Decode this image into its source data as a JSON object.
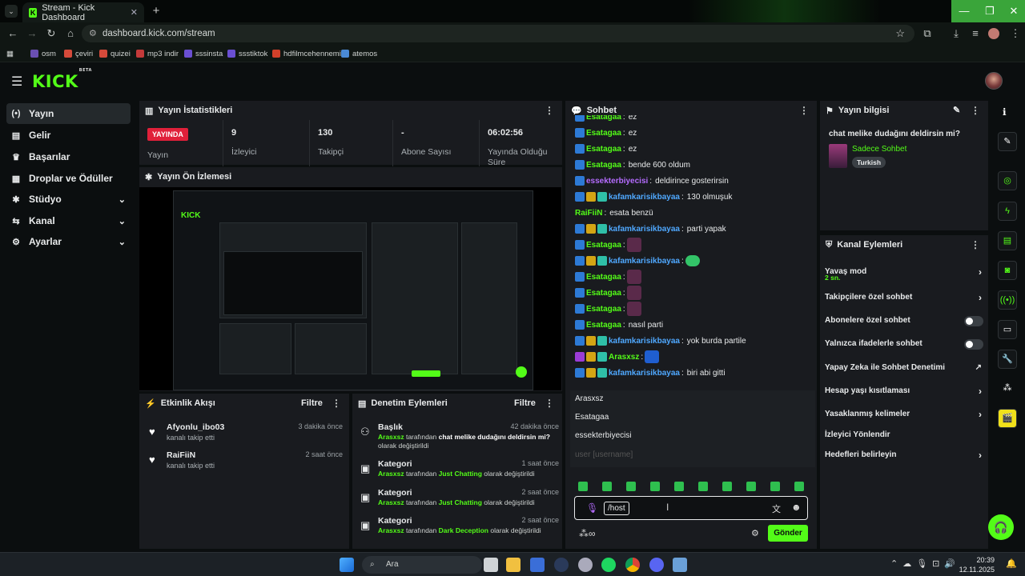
{
  "browser": {
    "tab_title": "Stream - Kick Dashboard",
    "url": "dashboard.kick.com/stream",
    "bookmarks": [
      "osm",
      "çeviri",
      "quizei",
      "mp3 indir",
      "sssinsta",
      "ssstiktok",
      "hdfilmcehennemi",
      "atemos"
    ]
  },
  "header": {
    "logo": "KICK",
    "logo_badge": "BETA"
  },
  "sidebar": {
    "items": [
      {
        "label": "Yayın",
        "icon": "(•)"
      },
      {
        "label": "Gelir",
        "icon": "▤"
      },
      {
        "label": "Başarılar",
        "icon": "🏆"
      },
      {
        "label": "Droplar ve Ödüller",
        "icon": "▦"
      },
      {
        "label": "Stüdyo",
        "icon": "✱"
      },
      {
        "label": "Kanal",
        "icon": "⇆"
      },
      {
        "label": "Ayarlar",
        "icon": "⚙"
      }
    ]
  },
  "stats": {
    "title": "Yayın İstatistikleri",
    "live_badge": "YAYINDA",
    "items": [
      {
        "value": "",
        "label": "Yayın"
      },
      {
        "value": "9",
        "label": "İzleyici"
      },
      {
        "value": "130",
        "label": "Takipçi"
      },
      {
        "value": "-",
        "label": "Abone Sayısı"
      },
      {
        "value": "06:02:56",
        "label": "Yayında Olduğu Süre"
      }
    ]
  },
  "preview": {
    "title": "Yayın Ön İzlemesi"
  },
  "activity": {
    "title": "Etkinlik Akışı",
    "filter": "Filtre",
    "items": [
      {
        "name": "Afyonlu_ibo03",
        "desc": "kanalı takip etti",
        "time": "3 dakika önce"
      },
      {
        "name": "RaiFiiN",
        "desc": "kanalı takip etti",
        "time": "2 saat önce"
      }
    ]
  },
  "moderation": {
    "title": "Denetim Eylemleri",
    "filter": "Filtre",
    "items": [
      {
        "heading": "Başlık",
        "time": "42 dakika önce",
        "user": "Arasxsz",
        "mid": " tarafından ",
        "value": "chat melike dudağını deldirsin mi?",
        "end": " olarak değiştirildi"
      },
      {
        "heading": "Kategori",
        "time": "1 saat önce",
        "user": "Arasxsz",
        "mid": " tarafından ",
        "value": "Just Chatting",
        "end": " olarak değiştirildi"
      },
      {
        "heading": "Kategori",
        "time": "2 saat önce",
        "user": "Arasxsz",
        "mid": " tarafından ",
        "value": "Just Chatting",
        "end": " olarak değiştirildi"
      },
      {
        "heading": "Kategori",
        "time": "2 saat önce",
        "user": "Arasxsz",
        "mid": " tarafından ",
        "value": "Dark Deception",
        "end": " olarak değiştirildi"
      }
    ]
  },
  "chat": {
    "title": "Sohbet",
    "messages": [
      {
        "user": "Esatagaa",
        "color": "#53fc18",
        "text": "ez",
        "badges": [
          "b1"
        ]
      },
      {
        "user": "Esatagaa",
        "color": "#53fc18",
        "text": "ez",
        "badges": [
          "b1"
        ]
      },
      {
        "user": "Esatagaa",
        "color": "#53fc18",
        "text": "ez",
        "badges": [
          "b1"
        ]
      },
      {
        "user": "Esatagaa",
        "color": "#53fc18",
        "text": "bende 600 oldum",
        "badges": [
          "b1"
        ]
      },
      {
        "user": "essekterbiyecisi",
        "color": "#b56cff",
        "text": "deldirince gosterirsin",
        "badges": [
          "b1"
        ]
      },
      {
        "user": "kafamkarisikbayaa",
        "color": "#4fa8ff",
        "text": "130 olmuşuk",
        "badges": [
          "b1",
          "b2",
          "b3"
        ]
      },
      {
        "user": "RaiFiiN",
        "color": "#53fc18",
        "text": "esata benzü",
        "badges": []
      },
      {
        "user": "kafamkarisikbayaa",
        "color": "#4fa8ff",
        "text": "parti yapak",
        "badges": [
          "b1",
          "b2",
          "b3"
        ]
      },
      {
        "user": "Esatagaa",
        "color": "#53fc18",
        "text": "",
        "badges": [
          "b1"
        ]
      },
      {
        "user": "kafamkarisikbayaa",
        "color": "#4fa8ff",
        "text": "",
        "badges": [
          "b1",
          "b2",
          "b3"
        ]
      },
      {
        "user": "Esatagaa",
        "color": "#53fc18",
        "text": "",
        "badges": [
          "b1"
        ]
      },
      {
        "user": "Esatagaa",
        "color": "#53fc18",
        "text": "",
        "badges": [
          "b1"
        ]
      },
      {
        "user": "Esatagaa",
        "color": "#53fc18",
        "text": "",
        "badges": [
          "b1"
        ]
      },
      {
        "user": "Esatagaa",
        "color": "#53fc18",
        "text": "nasıl parti",
        "badges": [
          "b1"
        ]
      },
      {
        "user": "kafamkarisikbayaa",
        "color": "#4fa8ff",
        "text": "yok burda partile",
        "badges": [
          "b1",
          "b2",
          "b3"
        ]
      },
      {
        "user": "Arasxsz",
        "color": "#53fc18",
        "text": "",
        "badges": [
          "b4",
          "b2",
          "b3"
        ]
      },
      {
        "user": "kafamkarisikbayaa",
        "color": "#4fa8ff",
        "text": "biri abi gitti",
        "badges": [
          "b1",
          "b2",
          "b3"
        ]
      }
    ],
    "autocomplete": [
      "Arasxsz",
      "Esatagaa",
      "essekterbiyecisi",
      "user [username]"
    ],
    "input_value": "/host",
    "send_label": "Gönder"
  },
  "stream_info": {
    "title": "Yayın bilgisi",
    "stream_title": "chat melike dudağını deldirsin mi?",
    "category": "Sadece Sohbet",
    "tag": "Turkish"
  },
  "channel_actions": {
    "title": "Kanal Eylemleri",
    "items": [
      {
        "label": "Yavaş mod",
        "sub": "2 sn.",
        "control": "arrow"
      },
      {
        "label": "Takipçilere özel sohbet",
        "control": "arrow"
      },
      {
        "label": "Abonelere özel sohbet",
        "control": "toggle"
      },
      {
        "label": "Yalnızca ifadelerle sohbet",
        "control": "toggle"
      },
      {
        "label": "Yapay Zeka ile Sohbet Denetimi",
        "control": "external"
      },
      {
        "label": "Hesap yaşı kısıtlaması",
        "control": "arrow"
      },
      {
        "label": "Yasaklanmış kelimeler",
        "control": "arrow"
      },
      {
        "label": "İzleyici Yönlendir",
        "control": "none"
      },
      {
        "label": "Hedefleri belirleyin",
        "control": "arrow"
      }
    ]
  },
  "taskbar": {
    "search_placeholder": "Ara",
    "time": "20:39",
    "date": "12.11.2025"
  }
}
